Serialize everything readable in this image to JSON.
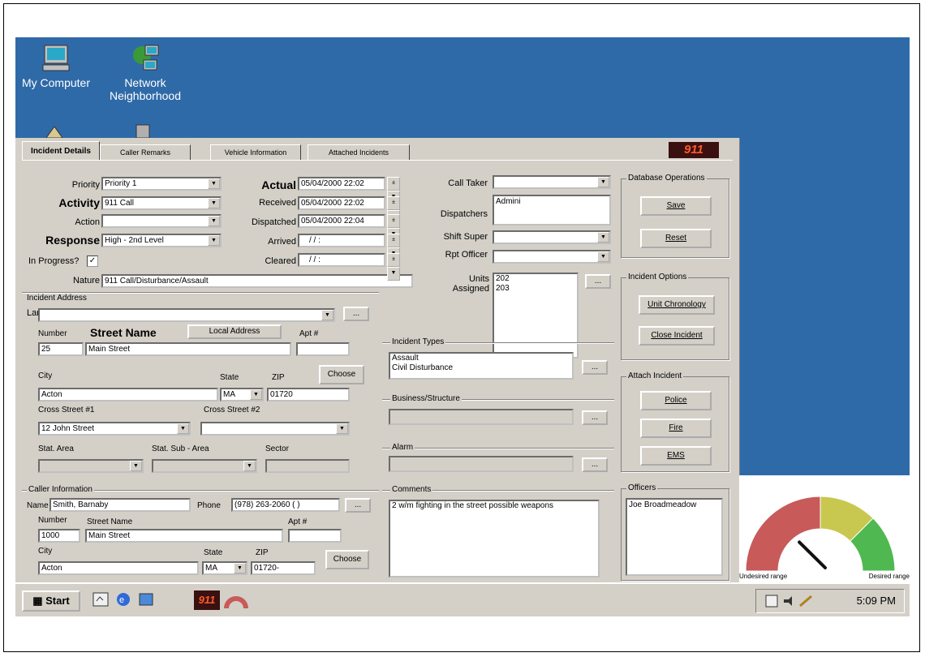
{
  "desktop": {
    "icons": [
      {
        "label": "My Computer",
        "icon": "computer-icon"
      },
      {
        "label": "Network Neighborhood",
        "icon": "network-icon"
      }
    ]
  },
  "app": {
    "tabs": [
      "Incident Details",
      "Caller Remarks",
      "Vehicle Information",
      "Attached Incidents"
    ],
    "logo": "911",
    "priority": {
      "label": "Priority",
      "value": "Priority 1"
    },
    "activity": {
      "label": "Activity",
      "value": "911 Call"
    },
    "action": {
      "label": "Action",
      "value": ""
    },
    "response": {
      "label": "Response",
      "value": "High - 2nd Level"
    },
    "in_progress": {
      "label": "In Progress?",
      "checked": true
    },
    "nature": {
      "label": "Nature",
      "value": "911 Call/Disturbance/Assault"
    },
    "times": {
      "actual": {
        "label": "Actual",
        "value": "05/04/2000 22:02"
      },
      "received": {
        "label": "Received",
        "value": "05/04/2000 22:02"
      },
      "dispatched": {
        "label": "Dispatched",
        "value": "05/04/2000 22:04"
      },
      "arrived": {
        "label": "Arrived",
        "value": "/    /          :"
      },
      "cleared": {
        "label": "Cleared",
        "value": "/    /          :"
      }
    },
    "call_taker": {
      "label": "Call Taker",
      "value": ""
    },
    "dispatchers": {
      "label": "Dispatchers",
      "value": "Admini"
    },
    "shift_super": {
      "label": "Shift Super",
      "value": ""
    },
    "rpt_officer": {
      "label": "Rpt Officer",
      "value": ""
    },
    "units": {
      "label1": "Units",
      "label2": "Assigned",
      "values": [
        "202",
        "203"
      ]
    },
    "incident_address": {
      "title": "Incident Address",
      "landmark_label": "Landmark",
      "landmark_value": "",
      "number_label": "Number",
      "number_value": "25",
      "street_label": "Street Name",
      "street_value": "Main Street",
      "local_address_label": "Local Address",
      "apt_label": "Apt #",
      "apt_value": "",
      "city_label": "City",
      "city_value": "Acton",
      "state_label": "State",
      "state_value": "MA",
      "zip_label": "ZIP",
      "zip_value": "01720",
      "choose_label": "Choose",
      "cross1_label": "Cross Street #1",
      "cross1_value": "12 John Street",
      "cross2_label": "Cross Street #2",
      "cross2_value": "",
      "stat_area_label": "Stat. Area",
      "stat_sub_label": "Stat. Sub - Area",
      "sector_label": "Sector"
    },
    "incident_types": {
      "title": "Incident Types",
      "values": [
        "Assault",
        "Civil Disturbance"
      ]
    },
    "business": {
      "title": "Business/Structure"
    },
    "alarm": {
      "title": "Alarm"
    },
    "comments": {
      "title": "Comments",
      "value": "2 w/m fighting in the street possible weapons"
    },
    "caller": {
      "title": "Caller Information",
      "name_label": "Name",
      "name_value": "Smith, Barnaby",
      "phone_label": "Phone",
      "phone_value": "(978) 263-2060  (   )",
      "number_label": "Number",
      "number_value": "1000",
      "street_label": "Street Name",
      "street_value": "Main Street",
      "apt_label": "Apt #",
      "city_label": "City",
      "city_value": "Acton",
      "state_label": "State",
      "state_value": "MA",
      "zip_label": "ZIP",
      "zip_value": "01720-",
      "choose_label": "Choose"
    },
    "db_ops": {
      "title": "Database Operations",
      "save": "Save",
      "reset": "Reset"
    },
    "incident_options": {
      "title": "Incident Options",
      "unit_chronology": "Unit Chronology",
      "close_incident": "Close Incident"
    },
    "attach_incident": {
      "title": "Attach Incident",
      "police": "Police",
      "fire": "Fire",
      "ems": "EMS"
    },
    "officers": {
      "title": "Officers",
      "value": "Joe Broadmeadow"
    },
    "ellipsis": "..."
  },
  "taskbar": {
    "start": "Start",
    "time": "5:09 PM",
    "app_button": "911"
  },
  "gauge": {
    "left_label": "Undesired range",
    "right_label": "Desired range",
    "level": 0.3,
    "colors": {
      "red": "#c85a5a",
      "yellow": "#c8c850",
      "green": "#50b850"
    }
  },
  "colors": {
    "desktop": "#2f6aa8",
    "window": "#d4d0c8"
  }
}
